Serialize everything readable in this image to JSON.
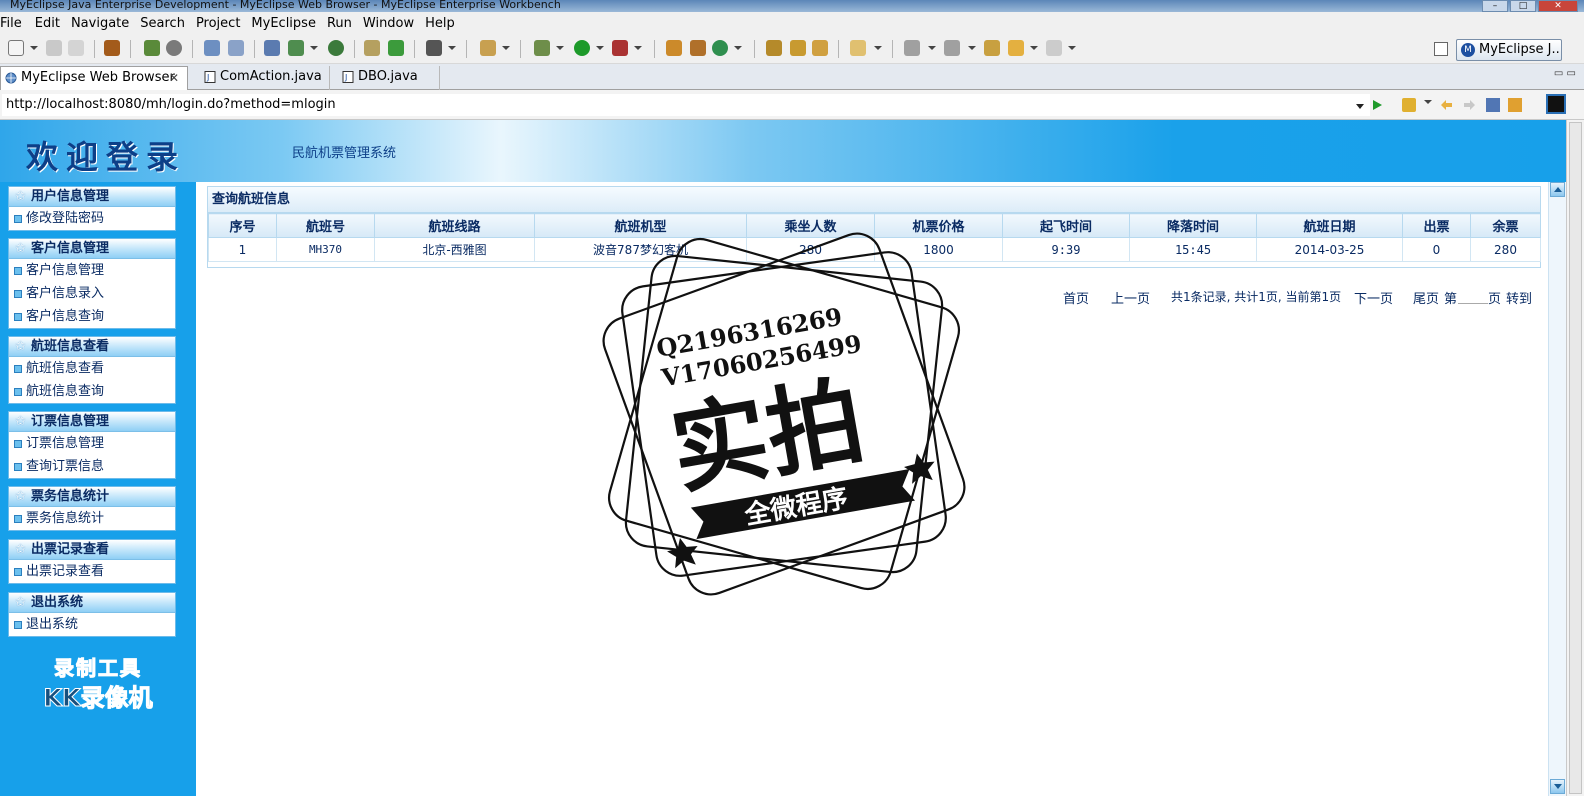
{
  "window": {
    "title": "MyEclipse Java Enterprise Development - MyEclipse Web Browser - MyEclipse Enterprise Workbench",
    "min": "–",
    "max": "□",
    "close": "✕"
  },
  "menu": [
    "File",
    "Edit",
    "Navigate",
    "Search",
    "Project",
    "MyEclipse",
    "Run",
    "Window",
    "Help"
  ],
  "perspective": {
    "label": "MyEclipse J..."
  },
  "tabs": [
    {
      "label": "MyEclipse Web Browser",
      "close": "✕"
    },
    {
      "label": "ComAction.java"
    },
    {
      "label": "DBO.java"
    }
  ],
  "tab_controls": "▭ ▭",
  "address": {
    "url": "http://localhost:8080/mh/login.do?method=mlogin"
  },
  "banner": {
    "welcome": "欢迎登录",
    "system_title": "民航机票管理系统"
  },
  "sidebar": {
    "groups": [
      {
        "title": "用户信息管理",
        "items": [
          "修改登陆密码"
        ]
      },
      {
        "title": "客户信息管理",
        "items": [
          "客户信息管理",
          "客户信息录入",
          "客户信息查询"
        ]
      },
      {
        "title": "航班信息查看",
        "items": [
          "航班信息查看",
          "航班信息查询"
        ]
      },
      {
        "title": "订票信息管理",
        "items": [
          "订票信息管理",
          "查询订票信息"
        ]
      },
      {
        "title": "票务信息统计",
        "items": [
          "票务信息统计"
        ]
      },
      {
        "title": "出票记录查看",
        "items": [
          "出票记录查看"
        ]
      },
      {
        "title": "退出系统",
        "items": [
          "退出系统"
        ]
      }
    ],
    "recorder_line1": "录制工具",
    "recorder_line2": "KK录像机"
  },
  "panel": {
    "title": "查询航班信息",
    "columns": [
      "序号",
      "航班号",
      "航班线路",
      "航班机型",
      "乘坐人数",
      "机票价格",
      "起飞时间",
      "降落时间",
      "航班日期",
      "出票",
      "余票"
    ],
    "rows": [
      [
        "1",
        "MH370",
        "北京-西雅图",
        "波音787梦幻客机",
        "280",
        "1800",
        "9:39",
        "15:45",
        "2014-03-25",
        "0",
        "280"
      ]
    ]
  },
  "pager": {
    "first": "首页",
    "prev": "上一页",
    "summary": "共1条记录, 共计1页, 当前第1页",
    "next": "下一页",
    "last": "尾页",
    "page_prefix": "第",
    "page_suffix": "页",
    "go": "转到"
  },
  "stamp": {
    "line1": "Q2196316269",
    "line2": "V17060256499",
    "big": "实拍",
    "ribbon": "全微程序"
  },
  "icons": {
    "tab_browser": "globe-icon",
    "tab_java": "java-file-icon",
    "go": "play-icon"
  },
  "colors": {
    "accent": "#17a0ea",
    "text_dark_blue": "#0a2b63"
  }
}
